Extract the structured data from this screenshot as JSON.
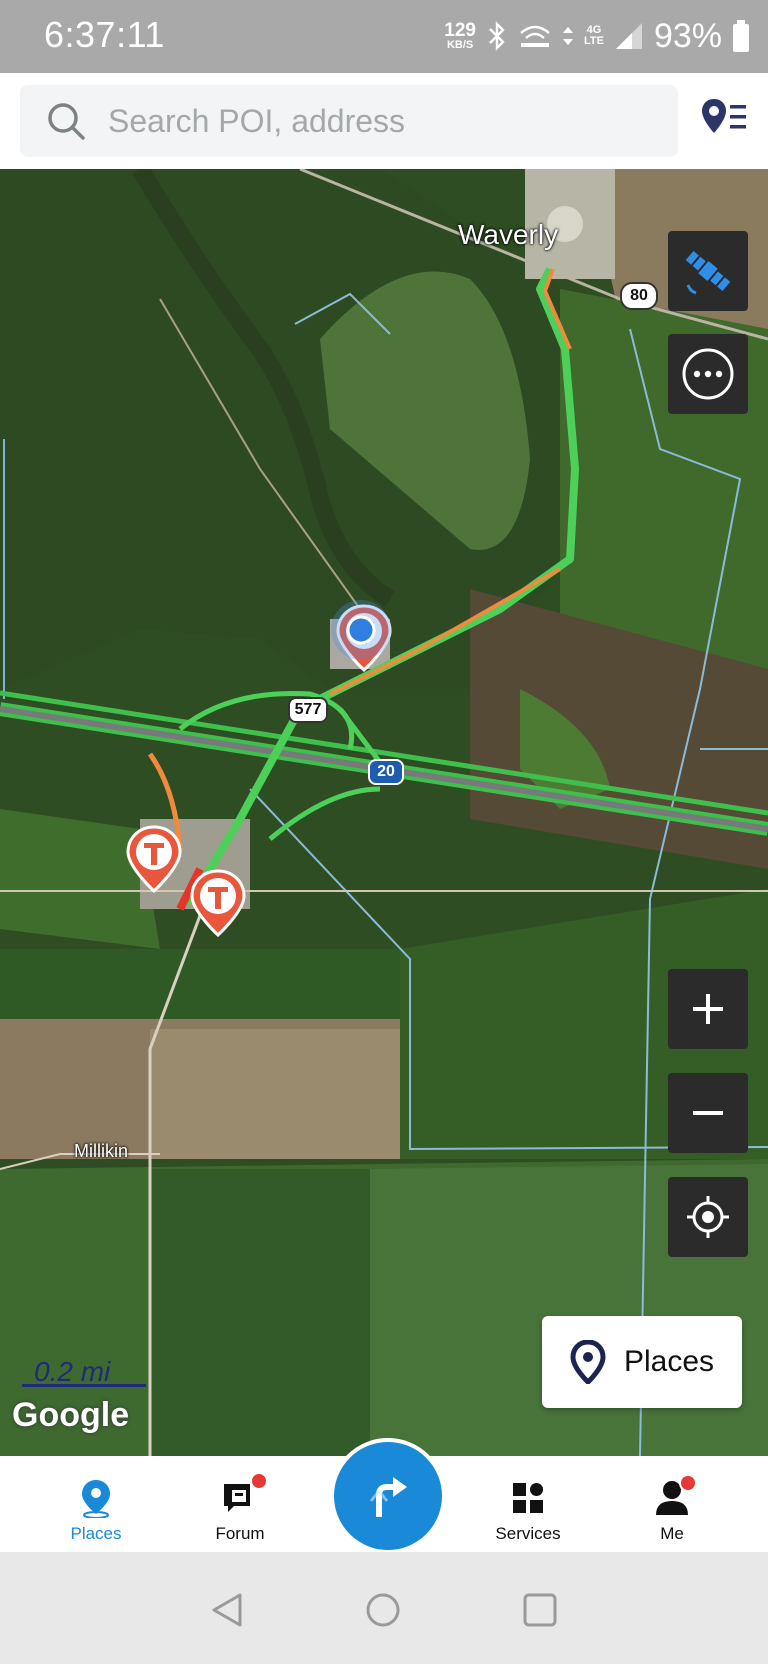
{
  "status_bar": {
    "time": "6:37:11",
    "network_speed": "129",
    "network_unit": "KB/S",
    "lte_top": "4G",
    "lte_bottom": "LTE",
    "battery": "93%"
  },
  "search": {
    "placeholder": "Search POI, address",
    "icon": "search-icon",
    "list_icon": "poi-list-icon"
  },
  "map": {
    "labels": {
      "town1": "Waverly",
      "town2": "Millikin",
      "road_577": "577",
      "road_20": "20",
      "road_80": "80"
    },
    "scale": "0.2 mi",
    "attribution": "Google",
    "controls": [
      "satellite-layer-icon",
      "more-options-icon",
      "zoom-in-icon",
      "zoom-out-icon",
      "my-location-icon"
    ],
    "places_button": "Places",
    "colors": {
      "traffic_green": "#4cd05a",
      "traffic_orange": "#f08a3c",
      "traffic_red": "#e5352b",
      "pin_red": "#e8573b",
      "location_blue": "#2f7fe0"
    }
  },
  "bottom_nav": {
    "tabs": [
      {
        "label": "Places",
        "icon": "places-pin-icon",
        "active": true
      },
      {
        "label": "Forum",
        "icon": "forum-icon",
        "badge": true
      },
      {
        "label": "Services",
        "icon": "services-grid-icon"
      },
      {
        "label": "Me",
        "icon": "person-icon",
        "badge": true
      }
    ],
    "center_button_icon": "navigate-turn-icon",
    "accent": "#1a8ad8"
  }
}
